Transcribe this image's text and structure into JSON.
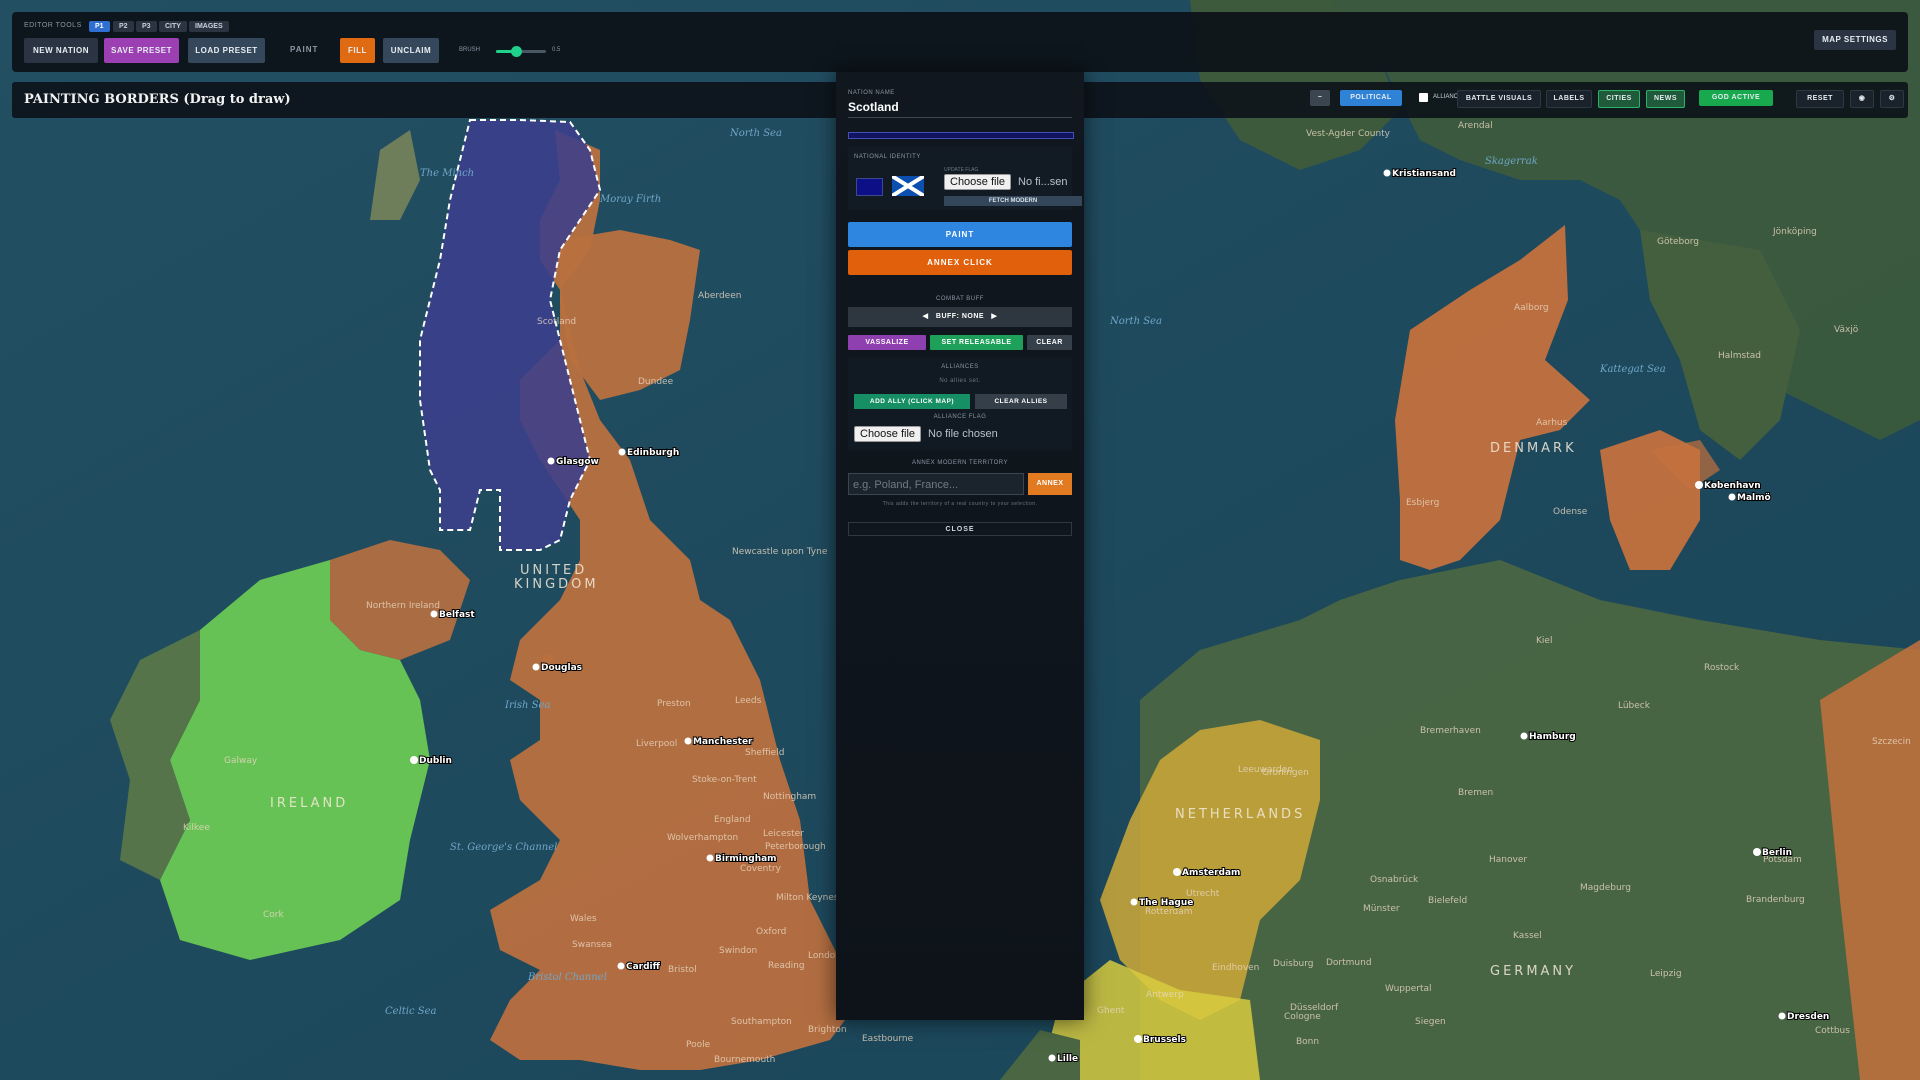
{
  "toolbar": {
    "caption": "EDITOR TOOLS",
    "tabs": [
      "P1",
      "P2",
      "P3",
      "CITY",
      "IMAGES"
    ],
    "active_tab": "P1",
    "new_nation": "NEW NATION",
    "save_preset": "SAVE PRESET",
    "load_preset": "LOAD PRESET",
    "paint": "PAINT",
    "fill": "FILL",
    "unclaim": "UNCLAIM",
    "brush_label": "BRUSH",
    "brush_value": "0.5",
    "brush_level": 0.4,
    "map_settings": "MAP SETTINGS"
  },
  "modebar": {
    "title": "PAINTING BORDERS (Drag to draw)",
    "minus": "−",
    "political": "POLITICAL",
    "alliance": "ALLIANCE",
    "battle_visuals": "BATTLE VISUALS",
    "labels": "LABELS",
    "cities": "CITIES",
    "news": "NEWS",
    "god_active": "GOD ACTIVE",
    "reset": "RESET",
    "eye": "◉",
    "gear": "⚙"
  },
  "panel": {
    "name_label": "NATION NAME",
    "name_value": "Scotland",
    "identity_label": "NATIONAL IDENTITY",
    "update_flag": "UPDATE FLAG",
    "choose_file": "Choose file",
    "file_status": "No fi...sen",
    "fetch_modern": "FETCH MODERN",
    "paint": "PAINT",
    "annex_click": "ANNEX CLICK",
    "combat_buff_label": "COMBAT BUFF",
    "buff": "BUFF: NONE",
    "vassalize": "VASSALIZE",
    "set_releasable": "SET RELEASABLE",
    "clear": "CLEAR",
    "alliances_label": "ALLIANCES",
    "no_allies": "No allies set.",
    "add_ally": "ADD ALLY (CLICK MAP)",
    "clear_allies": "CLEAR ALLIES",
    "alliance_flag_label": "ALLIANCE FLAG",
    "alliance_choose_file": "Choose file",
    "alliance_file_status": "No file chosen",
    "annex_modern_label": "ANNEX MODERN TERRITORY",
    "annex_placeholder": "e.g. Poland, France...",
    "annex": "ANNEX",
    "annex_note": "This adds the territory of a real country to your selection.",
    "close": "CLOSE"
  },
  "map": {
    "countries": [
      "IRELAND",
      "UNITED",
      "KINGDOM",
      "DENMARK",
      "NETHERLANDS",
      "GERMANY"
    ],
    "waters": [
      "North Sea",
      "The Minch",
      "Moray Firth",
      "Irish Sea",
      "St. George's Channel",
      "Celtic Sea",
      "Bristol Channel",
      "Skagerrak",
      "Kattegat Sea",
      "North Sea"
    ],
    "cities": [
      "Glasgow",
      "Edinburgh",
      "Belfast",
      "Douglas",
      "Dublin",
      "Manchester",
      "Birmingham",
      "Cardiff",
      "Kristiansand",
      "København",
      "Malmö",
      "Hamburg",
      "Amsterdam",
      "The Hague",
      "Brussels",
      "Berlin",
      "Dresden",
      "Lille"
    ],
    "places": [
      "Aberdeen",
      "Dundee",
      "Scotland",
      "Newcastle upon Tyne",
      "Leeds",
      "Preston",
      "Liverpool",
      "Sheffield",
      "Nottingham",
      "Leicester",
      "England",
      "Wolverhampton",
      "Peterborough",
      "Coventry",
      "Stoke-on-Trent",
      "Wales",
      "Swansea",
      "Bristol",
      "Swindon",
      "Oxford",
      "Reading",
      "London",
      "Milton Keynes",
      "Brighton",
      "Southampton",
      "Bournemouth",
      "Poole",
      "Eastbourne",
      "Northern Ireland",
      "Galway",
      "Kilkee",
      "Cork",
      "Arendal",
      "Vest-Agder County",
      "Göteborg",
      "Jönköping",
      "Halmstad",
      "Växjö",
      "Aalborg",
      "Aarhus",
      "Odense",
      "Esbjerg",
      "Kiel",
      "Rostock",
      "Lübeck",
      "Bremen",
      "Bremerhaven",
      "Groningen",
      "Leeuwarden",
      "Utrecht",
      "Rotterdam",
      "Eindhoven",
      "Antwerp",
      "Ghent",
      "Dortmund",
      "Duisburg",
      "Düsseldorf",
      "Cologne",
      "Bonn",
      "Münster",
      "Osnabrück",
      "Hanover",
      "Bielefeld",
      "Magdeburg",
      "Kassel",
      "Leipzig",
      "Potsdam",
      "Wuppertal",
      "Siegen",
      "Szczecin",
      "Cottbus",
      "Brandenburg"
    ]
  },
  "colors": {
    "accent_blue": "#2f83d6",
    "orange": "#e0600b",
    "purple": "#9b3fb2",
    "green": "#18a84e",
    "scotland_fill": "#3b3f8c",
    "ireland_fill": "#6fcf55",
    "uk_fill": "#c8743b"
  }
}
